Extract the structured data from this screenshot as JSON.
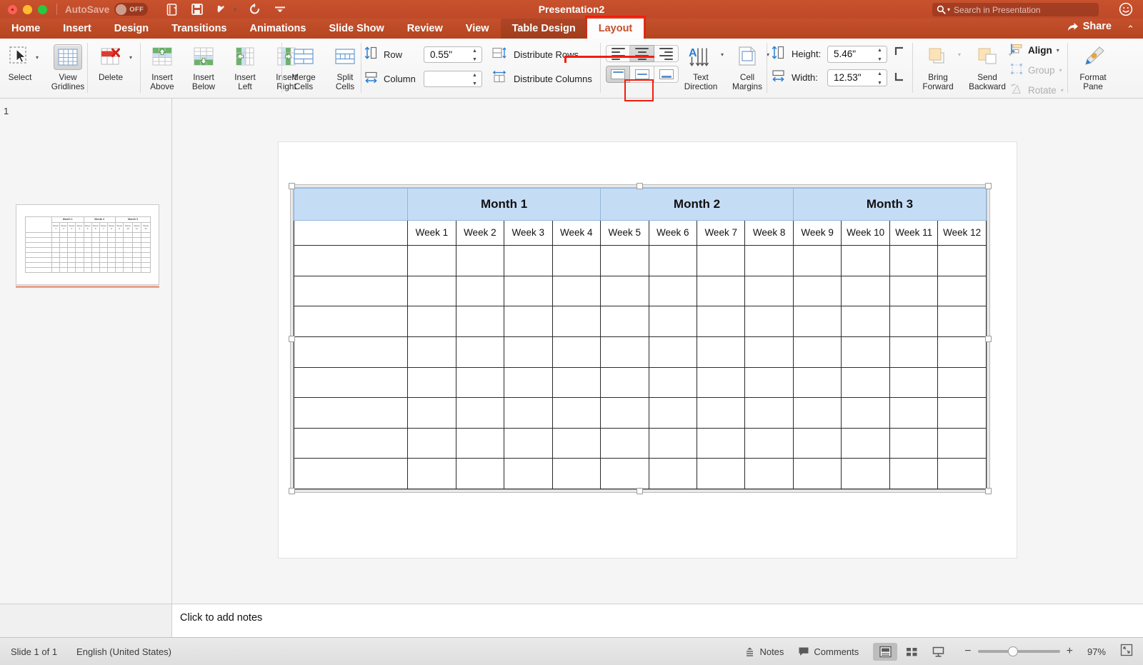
{
  "titlebar": {
    "autosave_label": "AutoSave",
    "autosave_state": "OFF",
    "document_title": "Presentation2",
    "search_placeholder": "Search in Presentation",
    "icons": [
      "new-slide-icon",
      "save-icon",
      "undo-icon",
      "redo-icon",
      "customize-toolbar-icon",
      "account-icon"
    ]
  },
  "tabs": {
    "items": [
      {
        "label": "Home",
        "active": false,
        "contextual": false
      },
      {
        "label": "Insert",
        "active": false,
        "contextual": false
      },
      {
        "label": "Design",
        "active": false,
        "contextual": false
      },
      {
        "label": "Transitions",
        "active": false,
        "contextual": false
      },
      {
        "label": "Animations",
        "active": false,
        "contextual": false
      },
      {
        "label": "Slide Show",
        "active": false,
        "contextual": false
      },
      {
        "label": "Review",
        "active": false,
        "contextual": false
      },
      {
        "label": "View",
        "active": false,
        "contextual": false
      },
      {
        "label": "Table Design",
        "active": false,
        "contextual": true
      },
      {
        "label": "Layout",
        "active": true,
        "contextual": true
      }
    ],
    "share_label": "Share",
    "highlighted_tab": "Layout"
  },
  "ribbon": {
    "select_label": "Select",
    "view_gridlines_label": "View\nGridlines",
    "view_gridlines_line1": "View",
    "view_gridlines_line2": "Gridlines",
    "delete_label": "Delete",
    "insert_above_l1": "Insert",
    "insert_above_l2": "Above",
    "insert_below_l1": "Insert",
    "insert_below_l2": "Below",
    "insert_left_l1": "Insert",
    "insert_left_l2": "Left",
    "insert_right_l1": "Insert",
    "insert_right_l2": "Right",
    "merge_cells_l1": "Merge",
    "merge_cells_l2": "Cells",
    "split_cells_l1": "Split",
    "split_cells_l2": "Cells",
    "row_label": "Row",
    "row_value": "0.55\"",
    "column_label": "Column",
    "column_value": "",
    "distribute_rows_label": "Distribute Rows",
    "distribute_columns_label": "Distribute Columns",
    "text_direction_l1": "Text",
    "text_direction_l2": "Direction",
    "cell_margins_l1": "Cell",
    "cell_margins_l2": "Margins",
    "height_label": "Height:",
    "height_value": "5.46\"",
    "width_label": "Width:",
    "width_value": "12.53\"",
    "bring_forward_l1": "Bring",
    "bring_forward_l2": "Forward",
    "send_backward_l1": "Send",
    "send_backward_l2": "Backward",
    "align_label": "Align",
    "group_label": "Group",
    "rotate_label": "Rotate",
    "format_pane_l1": "Format",
    "format_pane_l2": "Pane",
    "selected_horizontal_align": "center",
    "selected_vertical_align": "top",
    "highlight_color": "#f41c0b"
  },
  "slide_panel": {
    "slide_number": "1"
  },
  "table": {
    "month_headers": [
      "Month 1",
      "Month 2",
      "Month 3"
    ],
    "week_headers": [
      "Week 1",
      "Week 2",
      "Week 3",
      "Week 4",
      "Week 5",
      "Week 6",
      "Week 7",
      "Week 8",
      "Week 9",
      "Week 10",
      "Week 11",
      "Week 12"
    ],
    "body_row_count": 8,
    "header_fill": "#c5dcf5",
    "height": "5.46\"",
    "width": "12.53\""
  },
  "notes": {
    "placeholder": "Click to add notes"
  },
  "status": {
    "slide_count": "Slide 1 of 1",
    "language": "English (United States)",
    "notes_label": "Notes",
    "comments_label": "Comments",
    "zoom_percent": "97%",
    "active_view": "normal-view"
  }
}
